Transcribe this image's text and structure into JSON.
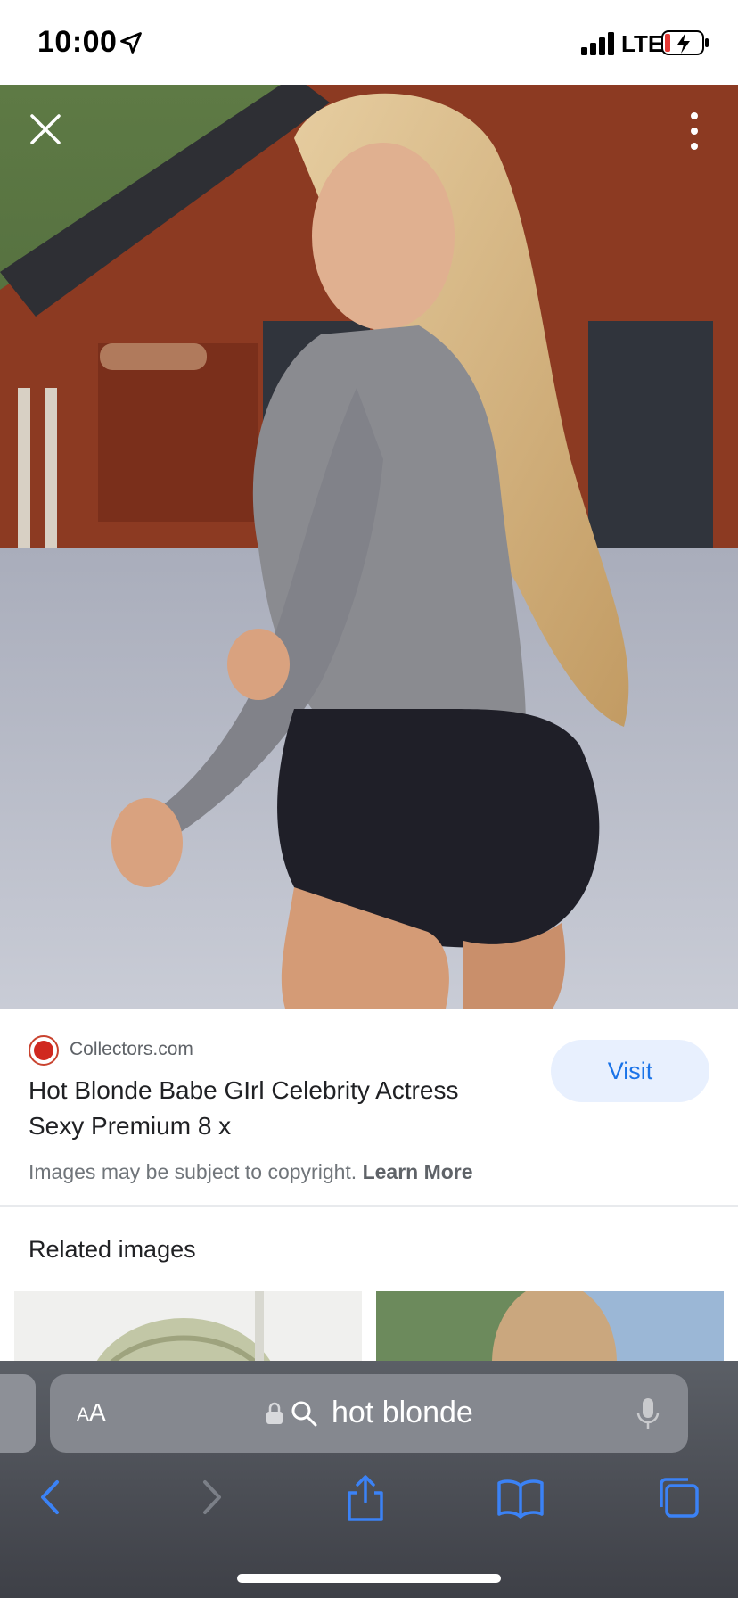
{
  "status_bar": {
    "time": "10:00",
    "network": "LTE"
  },
  "image_viewer": {
    "close_icon": "close-icon",
    "more_icon": "more-vertical-icon"
  },
  "result": {
    "source_name": "Collectors.com",
    "title": "Hot Blonde Babe GIrl Celebrity Actress Sexy Premium 8 x",
    "visit_label": "Visit",
    "copyright_text": "Images may be subject to copyright.",
    "learn_more_label": "Learn More",
    "related_title": "Related images"
  },
  "safari": {
    "aa_label_small": "A",
    "aa_label_large": "A",
    "url_text": "hot blonde",
    "accent_color": "#3b82f6",
    "nav_icons": [
      "back-icon",
      "forward-icon",
      "share-icon",
      "bookmarks-icon",
      "tabs-icon"
    ]
  }
}
